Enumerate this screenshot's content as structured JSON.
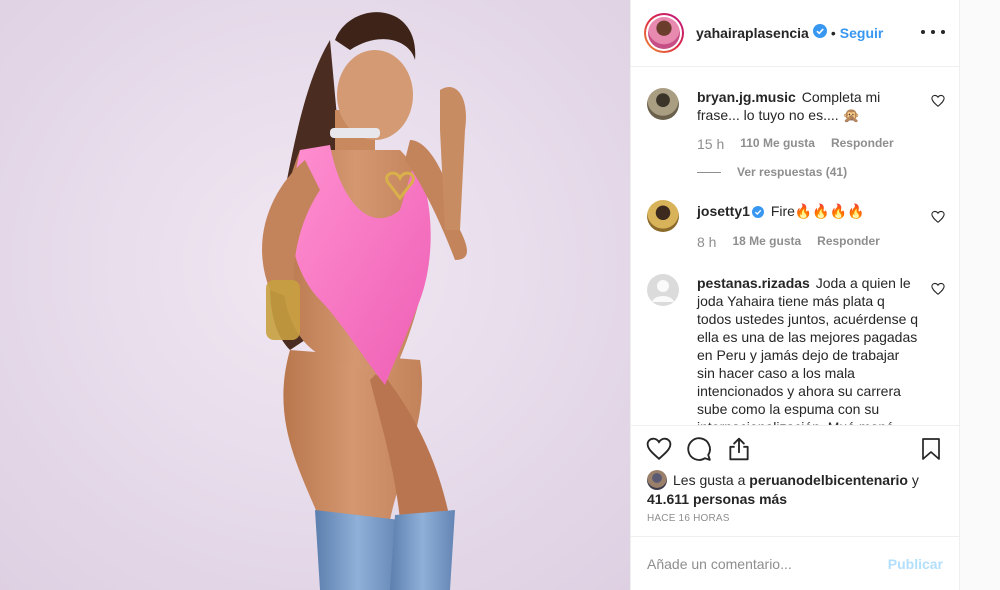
{
  "header": {
    "username": "yahairaplasencia",
    "verified": true,
    "separator": "•",
    "follow_label": "Seguir"
  },
  "comments": [
    {
      "username": "bryan.jg.music",
      "text": "Completa mi frase... lo tuyo no es.... 🙊",
      "time": "15 h",
      "likes": "110 Me gusta",
      "reply_label": "Responder",
      "view_replies": "Ver respuestas (41)"
    },
    {
      "username": "josetty1",
      "verified": true,
      "text": "Fire🔥🔥🔥🔥",
      "time": "8 h",
      "likes": "18 Me gusta",
      "reply_label": "Responder"
    },
    {
      "username": "pestanas.rizadas",
      "text": "Joda a quien le joda Yahaira tiene más plata q todos ustedes juntos, acuérdense q ella es una de las mejores pagadas en Peru y jamás dejo de trabajar sin hacer caso a los mala intencionados y ahora su carrera sube como la espuma con su internacionalización. Muá moná"
    }
  ],
  "actions": {
    "like": "heart-icon",
    "comment": "comment-icon",
    "share": "share-icon",
    "save": "bookmark-icon"
  },
  "likes": {
    "prefix": "Les gusta a",
    "user": "peruanodelbicentenario",
    "connector": "y",
    "others": "41.611 personas más"
  },
  "time_ago": "Hace 16 horas",
  "add_comment": {
    "placeholder": "Añade un comentario...",
    "publish_label": "Publicar"
  },
  "colors": {
    "link_blue": "#3897f0",
    "publish_disabled": "#b2dffc",
    "muted": "#8e8e8e",
    "text": "#262626",
    "photo_background": "#e6dbea",
    "bodysuit_pink": "#f06bbd",
    "denim": "#7a9cc8"
  }
}
